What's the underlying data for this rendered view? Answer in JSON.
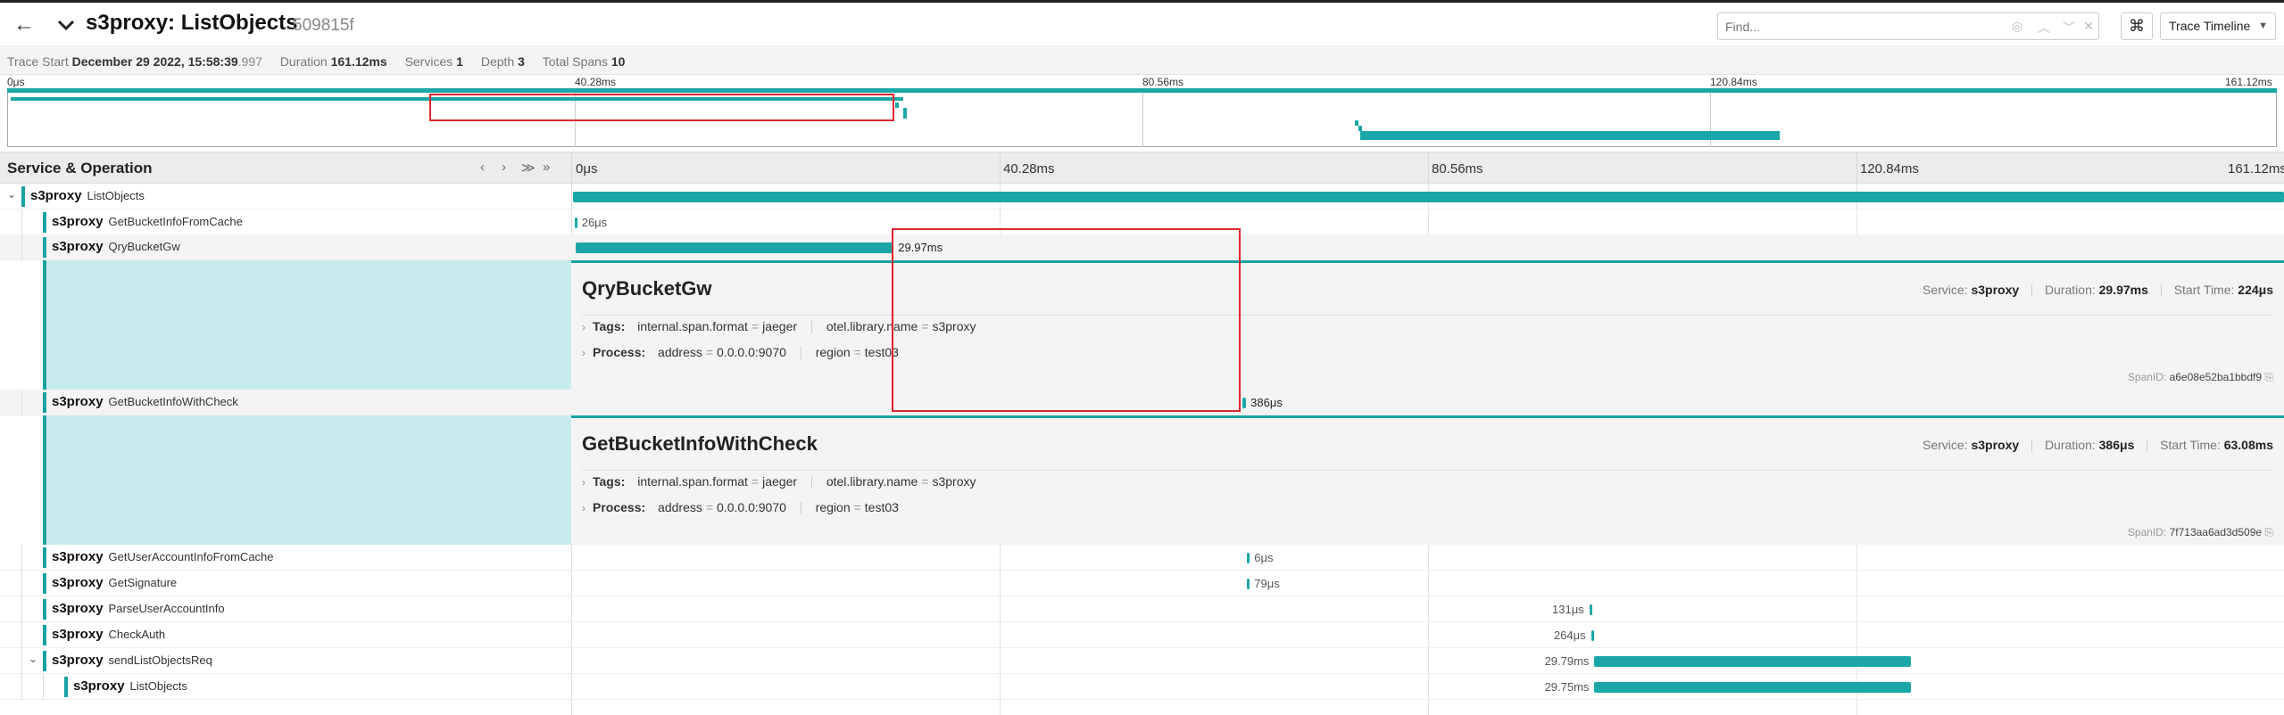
{
  "header": {
    "back_icon": "arrow-left-icon",
    "title": "s3proxy: ListObjects",
    "trace_id": "509815f",
    "find_placeholder": "Find...",
    "find_controls": [
      "◎",
      "︿",
      "﹀",
      "✕"
    ],
    "keyboard_icon": "⌘",
    "view_mode": "Trace Timeline"
  },
  "summary": {
    "trace_start_label": "Trace Start",
    "trace_start_value": "December 29 2022, 15:58:39",
    "trace_start_ms": ".997",
    "duration_label": "Duration",
    "duration_value": "161.12ms",
    "services_label": "Services",
    "services_value": "1",
    "depth_label": "Depth",
    "depth_value": "3",
    "spans_label": "Total Spans",
    "spans_value": "10"
  },
  "ticks": [
    "0μs",
    "40.28ms",
    "80.56ms",
    "120.84ms",
    "161.12ms"
  ],
  "column_header": {
    "title": "Service & Operation",
    "controls": [
      "‹",
      "›",
      "≫",
      "»"
    ]
  },
  "spans": [
    {
      "service": "s3proxy",
      "operation": "ListObjects",
      "depth": 0,
      "collapsible": true,
      "start": 0.0,
      "duration": 1.0,
      "label": ""
    },
    {
      "service": "s3proxy",
      "operation": "GetBucketInfoFromCache",
      "depth": 1,
      "collapsible": false,
      "start": 0.0009,
      "duration": 0.0015,
      "label": "26μs"
    },
    {
      "service": "s3proxy",
      "operation": "QryBucketGw",
      "depth": 1,
      "collapsible": false,
      "start": 0.0014,
      "duration": 0.186,
      "label": "29.97ms",
      "expanded": true
    },
    {
      "service": "s3proxy",
      "operation": "GetBucketInfoWithCheck",
      "depth": 1,
      "collapsible": false,
      "start": 0.391,
      "duration": 0.0024,
      "label": "386μs",
      "expanded": true
    },
    {
      "service": "s3proxy",
      "operation": "GetUserAccountInfoFromCache",
      "depth": 1,
      "collapsible": false,
      "start": 0.394,
      "duration": 0.0012,
      "label": "6μs"
    },
    {
      "service": "s3proxy",
      "operation": "GetSignature",
      "depth": 1,
      "collapsible": false,
      "start": 0.394,
      "duration": 0.0014,
      "label": "79μs"
    },
    {
      "service": "s3proxy",
      "operation": "ParseUserAccountInfo",
      "depth": 1,
      "collapsible": false,
      "start": 0.594,
      "duration": 0.0013,
      "label": "131μs",
      "label_left": true
    },
    {
      "service": "s3proxy",
      "operation": "CheckAuth",
      "depth": 1,
      "collapsible": false,
      "start": 0.595,
      "duration": 0.0019,
      "label": "264μs",
      "label_left": true
    },
    {
      "service": "s3proxy",
      "operation": "sendListObjectsReq",
      "depth": 1,
      "collapsible": true,
      "start": 0.597,
      "duration": 0.185,
      "label": "29.79ms",
      "label_left": true
    },
    {
      "service": "s3proxy",
      "operation": "ListObjects",
      "depth": 2,
      "collapsible": false,
      "start": 0.597,
      "duration": 0.185,
      "label": "29.75ms",
      "label_left": true
    }
  ],
  "details": [
    {
      "title": "QryBucketGw",
      "service_label": "Service:",
      "service": "s3proxy",
      "duration_label": "Duration:",
      "duration": "29.97ms",
      "start_label": "Start Time:",
      "start": "224μs",
      "tags_label": "Tags:",
      "tags": [
        {
          "k": "internal.span.format",
          "v": "jaeger"
        },
        {
          "k": "otel.library.name",
          "v": "s3proxy"
        }
      ],
      "process_label": "Process:",
      "process": [
        {
          "k": "address",
          "v": "0.0.0.0:9070"
        },
        {
          "k": "region",
          "v": "test03"
        }
      ],
      "spanid_label": "SpanID:",
      "spanid": "a6e08e52ba1bbdf9"
    },
    {
      "title": "GetBucketInfoWithCheck",
      "service_label": "Service:",
      "service": "s3proxy",
      "duration_label": "Duration:",
      "duration": "386μs",
      "start_label": "Start Time:",
      "start": "63.08ms",
      "tags_label": "Tags:",
      "tags": [
        {
          "k": "internal.span.format",
          "v": "jaeger"
        },
        {
          "k": "otel.library.name",
          "v": "s3proxy"
        }
      ],
      "process_label": "Process:",
      "process": [
        {
          "k": "address",
          "v": "0.0.0.0:9070"
        },
        {
          "k": "region",
          "v": "test03"
        }
      ],
      "spanid_label": "SpanID:",
      "spanid": "7f713aa6ad3d509e"
    }
  ],
  "colors": {
    "span": "#1ba7a7",
    "highlight": "#e0262d",
    "expanded_tint": "#c7ecee"
  }
}
